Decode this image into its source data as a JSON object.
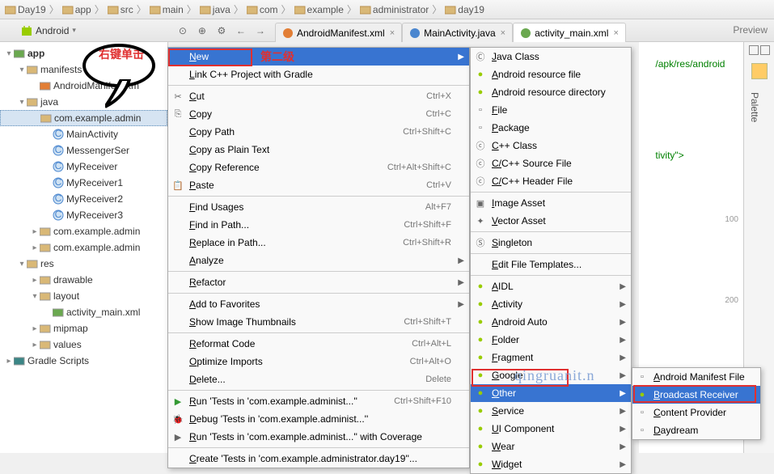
{
  "breadcrumb": [
    "Day19",
    "app",
    "src",
    "main",
    "java",
    "com",
    "example",
    "administrator",
    "day19"
  ],
  "toolbar": {
    "combo": "Android"
  },
  "tabs": [
    {
      "label": "AndroidManifest.xml",
      "icon": "xml"
    },
    {
      "label": "MainActivity.java",
      "icon": "java"
    },
    {
      "label": "activity_main.xml",
      "icon": "layout",
      "active": true
    }
  ],
  "preview": "Preview",
  "palette": "Palette",
  "annotations": {
    "right_click": "右键单击",
    "level2": "第二级"
  },
  "watermark": "qingruanit.n",
  "tree": [
    {
      "d": 0,
      "exp": "▾",
      "icon": "mod",
      "label": "app",
      "bold": true
    },
    {
      "d": 1,
      "exp": "▾",
      "icon": "dir",
      "label": "manifests"
    },
    {
      "d": 2,
      "exp": "",
      "icon": "xml",
      "label": "AndroidManifest.xm"
    },
    {
      "d": 1,
      "exp": "▾",
      "icon": "dir",
      "label": "java"
    },
    {
      "d": 2,
      "exp": "",
      "icon": "pkg",
      "label": "com.example.admin",
      "sel": true
    },
    {
      "d": 3,
      "exp": "",
      "icon": "cls",
      "label": "MainActivity"
    },
    {
      "d": 3,
      "exp": "",
      "icon": "cls",
      "label": "MessengerSer"
    },
    {
      "d": 3,
      "exp": "",
      "icon": "cls",
      "label": "MyReceiver"
    },
    {
      "d": 3,
      "exp": "",
      "icon": "cls",
      "label": "MyReceiver1"
    },
    {
      "d": 3,
      "exp": "",
      "icon": "cls",
      "label": "MyReceiver2"
    },
    {
      "d": 3,
      "exp": "",
      "icon": "cls",
      "label": "MyReceiver3"
    },
    {
      "d": 2,
      "exp": "▸",
      "icon": "pkg",
      "label": "com.example.admin"
    },
    {
      "d": 2,
      "exp": "▸",
      "icon": "pkg",
      "label": "com.example.admin"
    },
    {
      "d": 1,
      "exp": "▾",
      "icon": "dir",
      "label": "res"
    },
    {
      "d": 2,
      "exp": "▸",
      "icon": "dir",
      "label": "drawable"
    },
    {
      "d": 2,
      "exp": "▾",
      "icon": "dir",
      "label": "layout"
    },
    {
      "d": 3,
      "exp": "",
      "icon": "lay",
      "label": "activity_main.xml"
    },
    {
      "d": 2,
      "exp": "▸",
      "icon": "dir",
      "label": "mipmap"
    },
    {
      "d": 2,
      "exp": "▸",
      "icon": "dir",
      "label": "values"
    },
    {
      "d": 0,
      "exp": "▸",
      "icon": "grd",
      "label": "Gradle Scripts"
    }
  ],
  "menu1": [
    {
      "t": "New",
      "arrow": true,
      "hi": true
    },
    {
      "t": "Link C++ Project with Gradle"
    },
    {
      "sep": true
    },
    {
      "t": "Cut",
      "sc": "Ctrl+X",
      "ic": "cut"
    },
    {
      "t": "Copy",
      "sc": "Ctrl+C",
      "ic": "copy"
    },
    {
      "t": "Copy Path",
      "sc": "Ctrl+Shift+C"
    },
    {
      "t": "Copy as Plain Text"
    },
    {
      "t": "Copy Reference",
      "sc": "Ctrl+Alt+Shift+C"
    },
    {
      "t": "Paste",
      "sc": "Ctrl+V",
      "ic": "paste"
    },
    {
      "sep": true
    },
    {
      "t": "Find Usages",
      "sc": "Alt+F7"
    },
    {
      "t": "Find in Path...",
      "sc": "Ctrl+Shift+F"
    },
    {
      "t": "Replace in Path...",
      "sc": "Ctrl+Shift+R"
    },
    {
      "t": "Analyze",
      "arrow": true
    },
    {
      "sep": true
    },
    {
      "t": "Refactor",
      "arrow": true
    },
    {
      "sep": true
    },
    {
      "t": "Add to Favorites",
      "arrow": true
    },
    {
      "t": "Show Image Thumbnails",
      "sc": "Ctrl+Shift+T"
    },
    {
      "sep": true
    },
    {
      "t": "Reformat Code",
      "sc": "Ctrl+Alt+L"
    },
    {
      "t": "Optimize Imports",
      "sc": "Ctrl+Alt+O"
    },
    {
      "t": "Delete...",
      "sc": "Delete"
    },
    {
      "sep": true
    },
    {
      "t": "Run 'Tests in 'com.example.administ...''",
      "sc": "Ctrl+Shift+F10",
      "ic": "run"
    },
    {
      "t": "Debug 'Tests in 'com.example.administ...''",
      "ic": "dbg"
    },
    {
      "t": "Run 'Tests in 'com.example.administ...'' with Coverage",
      "ic": "cov"
    },
    {
      "sep": true
    },
    {
      "t": "Create 'Tests in 'com.example.administrator.day19''..."
    }
  ],
  "menu2": [
    {
      "t": "Java Class",
      "ic": "cls"
    },
    {
      "t": "Android resource file",
      "ic": "and"
    },
    {
      "t": "Android resource directory",
      "ic": "and"
    },
    {
      "t": "File",
      "ic": "file"
    },
    {
      "t": "Package",
      "ic": "pkg"
    },
    {
      "t": "C++ Class",
      "ic": "cpp"
    },
    {
      "t": "C/C++ Source File",
      "ic": "cpp"
    },
    {
      "t": "C/C++ Header File",
      "ic": "cpp"
    },
    {
      "sep": true
    },
    {
      "t": "Image Asset",
      "ic": "img"
    },
    {
      "t": "Vector Asset",
      "ic": "vec"
    },
    {
      "sep": true
    },
    {
      "t": "Singleton",
      "ic": "sng"
    },
    {
      "sep": true
    },
    {
      "t": "Edit File Templates..."
    },
    {
      "sep": true
    },
    {
      "t": "AIDL",
      "arrow": true,
      "ic": "and"
    },
    {
      "t": "Activity",
      "arrow": true,
      "ic": "and"
    },
    {
      "t": "Android Auto",
      "arrow": true,
      "ic": "and"
    },
    {
      "t": "Folder",
      "arrow": true,
      "ic": "and"
    },
    {
      "t": "Fragment",
      "arrow": true,
      "ic": "and"
    },
    {
      "t": "Google",
      "arrow": true,
      "ic": "and"
    },
    {
      "t": "Other",
      "arrow": true,
      "ic": "and",
      "hi": true
    },
    {
      "t": "Service",
      "arrow": true,
      "ic": "and"
    },
    {
      "t": "UI Component",
      "arrow": true,
      "ic": "and"
    },
    {
      "t": "Wear",
      "arrow": true,
      "ic": "and"
    },
    {
      "t": "Widget",
      "arrow": true,
      "ic": "and"
    }
  ],
  "menu3": [
    {
      "t": "Android Manifest File",
      "ic": "file"
    },
    {
      "t": "Broadcast Receiver",
      "ic": "and",
      "hi": true
    },
    {
      "t": "Content Provider",
      "ic": "file"
    },
    {
      "t": "Daydream",
      "ic": "file"
    }
  ],
  "editor": {
    "l1": "/apk/res/android",
    "l2": "tivity\">",
    "ruler": [
      "100",
      "200"
    ]
  }
}
